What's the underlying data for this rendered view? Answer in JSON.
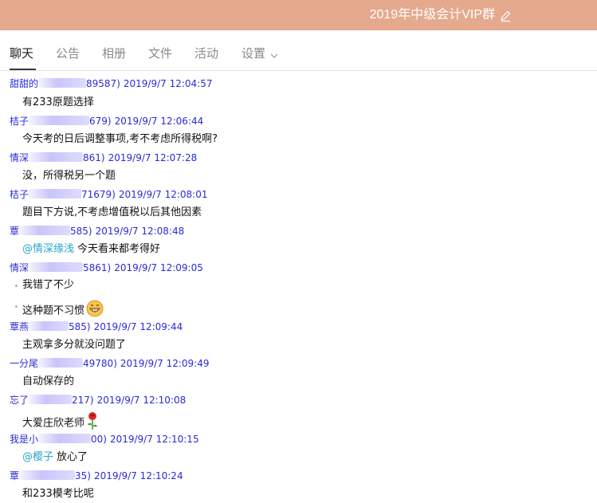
{
  "window": {
    "title": "2019年中级会计VIP群",
    "colors": {
      "titlebar_bg": "#e5a98d",
      "link_blue": "#2a2ad9",
      "mention_cyan": "#2aa7c9"
    }
  },
  "tabs": [
    {
      "label": "聊天",
      "active": true
    },
    {
      "label": "公告"
    },
    {
      "label": "相册"
    },
    {
      "label": "文件"
    },
    {
      "label": "活动"
    },
    {
      "label": "设置"
    }
  ],
  "messages": [
    {
      "sender": "甜甜的",
      "qq_visible": "89587)",
      "time": "2019/9/7 12:04:57",
      "text": "有233原题选择"
    },
    {
      "sender": "桔子",
      "qq_visible": "679)",
      "time": "2019/9/7 12:06:44",
      "text": "今天考的日后调整事项,考不考虑所得税啊?"
    },
    {
      "sender": "情深",
      "qq_visible": "861)",
      "time": "2019/9/7 12:07:28",
      "text": "没，所得税另一个题"
    },
    {
      "sender": "桔子",
      "qq_visible": "71679)",
      "time": "2019/9/7 12:08:01",
      "text": "题目下方说,不考虑增值税以后其他因素"
    },
    {
      "sender": "覃",
      "qq_visible": "585)",
      "time": "2019/9/7 12:08:48",
      "mention": "@情深缘浅",
      "text": "今天看来都考得好"
    },
    {
      "sender": "情深",
      "qq_visible": "5861)",
      "time": "2019/9/7 12:09:05",
      "text": "我错了不少",
      "text2": "这种题不习惯",
      "emoji": "grin-emoji-icon"
    },
    {
      "sender": "覃燕",
      "qq_visible": "585)",
      "time": "2019/9/7 12:09:44",
      "text": "主观拿多分就没问题了"
    },
    {
      "sender": "一分尾",
      "qq_visible": "49780)",
      "time": "2019/9/7 12:09:49",
      "text": "自动保存的"
    },
    {
      "sender": "忘了",
      "qq_visible": "217)",
      "time": "2019/9/7 12:10:08",
      "text": "大爱庄欣老师",
      "emoji": "rose-emoji-icon"
    },
    {
      "sender": "我是小",
      "qq_visible": "00)",
      "time": "2019/9/7 12:10:15",
      "mention": "@樱子",
      "text": "放心了"
    },
    {
      "sender": "覃",
      "qq_visible": "35)",
      "time": "2019/9/7 12:10:24",
      "text": "和233模考比呢"
    }
  ]
}
